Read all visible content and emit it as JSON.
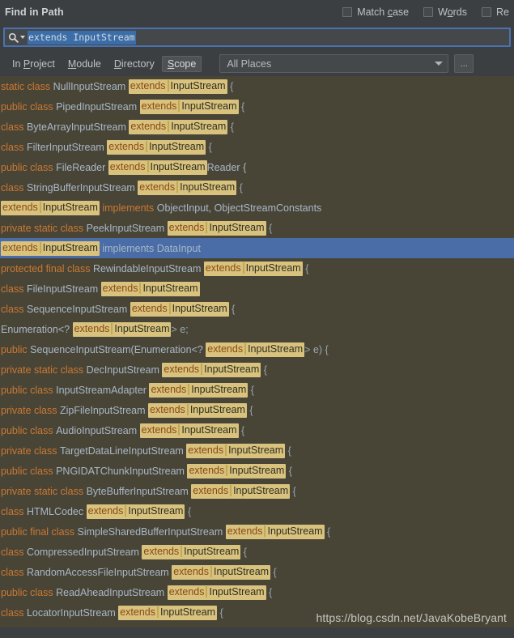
{
  "dialog": {
    "title": "Find in Path"
  },
  "options": [
    {
      "id": "match-case",
      "label_before": "Match ",
      "mnemonic": "c",
      "label_after": "ase",
      "checked": false
    },
    {
      "id": "words",
      "label_before": "W",
      "mnemonic": "o",
      "label_after": "rds",
      "checked": false
    },
    {
      "id": "regex",
      "label_before": "Re",
      "mnemonic": "",
      "label_after": "",
      "checked": false
    }
  ],
  "search": {
    "icon": "search-icon",
    "value": "extends InputStream",
    "selected": true
  },
  "scope": {
    "tabs": [
      {
        "id": "in-project",
        "before": "In ",
        "mnemonic": "P",
        "after": "roject",
        "selected": false
      },
      {
        "id": "module",
        "before": "",
        "mnemonic": "M",
        "after": "odule",
        "selected": false
      },
      {
        "id": "directory",
        "before": "",
        "mnemonic": "D",
        "after": "irectory",
        "selected": false
      },
      {
        "id": "scope",
        "before": "",
        "mnemonic": "S",
        "after": "cope",
        "selected": true
      }
    ],
    "place_value": "All Places",
    "ellipsis_label": "..."
  },
  "results": {
    "highlight_text": {
      "keyword": "extends",
      "identifier": "InputStream"
    },
    "rows": [
      {
        "selected": false,
        "parts": [
          {
            "t": "kw",
            "v": "static class "
          },
          {
            "t": "plain",
            "v": "NullInputStream "
          },
          {
            "t": "hl"
          },
          {
            "t": "punc",
            "v": " {"
          }
        ]
      },
      {
        "selected": false,
        "parts": [
          {
            "t": "kw",
            "v": "public class "
          },
          {
            "t": "plain",
            "v": "PipedInputStream "
          },
          {
            "t": "hl"
          },
          {
            "t": "punc",
            "v": " {"
          }
        ]
      },
      {
        "selected": false,
        "parts": [
          {
            "t": "kw",
            "v": "class "
          },
          {
            "t": "plain",
            "v": "ByteArrayInputStream "
          },
          {
            "t": "hl"
          },
          {
            "t": "punc",
            "v": " {"
          }
        ]
      },
      {
        "selected": false,
        "parts": [
          {
            "t": "kw",
            "v": "class "
          },
          {
            "t": "plain",
            "v": "FilterInputStream "
          },
          {
            "t": "hl"
          },
          {
            "t": "punc",
            "v": " {"
          }
        ]
      },
      {
        "selected": false,
        "parts": [
          {
            "t": "kw",
            "v": "public class "
          },
          {
            "t": "plain",
            "v": "FileReader "
          },
          {
            "t": "hl"
          },
          {
            "t": "plain",
            "v": "Reader {"
          }
        ]
      },
      {
        "selected": false,
        "parts": [
          {
            "t": "kw",
            "v": "class "
          },
          {
            "t": "plain",
            "v": "StringBufferInputStream "
          },
          {
            "t": "hl"
          },
          {
            "t": "punc",
            "v": " {"
          }
        ]
      },
      {
        "selected": false,
        "parts": [
          {
            "t": "hl"
          },
          {
            "t": "kw",
            "v": " implements "
          },
          {
            "t": "plain",
            "v": "ObjectInput, ObjectStreamConstants"
          }
        ]
      },
      {
        "selected": false,
        "parts": [
          {
            "t": "kw",
            "v": "private static class "
          },
          {
            "t": "plain",
            "v": "PeekInputStream "
          },
          {
            "t": "hl"
          },
          {
            "t": "punc",
            "v": " {"
          }
        ]
      },
      {
        "selected": true,
        "parts": [
          {
            "t": "hl"
          },
          {
            "t": "plain",
            "v": " implements DataInput"
          }
        ]
      },
      {
        "selected": false,
        "parts": [
          {
            "t": "kw",
            "v": "protected final class "
          },
          {
            "t": "plain",
            "v": "RewindableInputStream "
          },
          {
            "t": "hl"
          },
          {
            "t": "punc",
            "v": " {"
          }
        ]
      },
      {
        "selected": false,
        "parts": [
          {
            "t": "kw",
            "v": "class "
          },
          {
            "t": "plain",
            "v": "FileInputStream "
          },
          {
            "t": "hl"
          }
        ]
      },
      {
        "selected": false,
        "parts": [
          {
            "t": "kw",
            "v": "class "
          },
          {
            "t": "plain",
            "v": "SequenceInputStream "
          },
          {
            "t": "hl"
          },
          {
            "t": "punc",
            "v": " {"
          }
        ]
      },
      {
        "selected": false,
        "parts": [
          {
            "t": "plain",
            "v": "Enumeration<? "
          },
          {
            "t": "hl"
          },
          {
            "t": "punc",
            "v": "> e;"
          }
        ]
      },
      {
        "selected": false,
        "parts": [
          {
            "t": "kw",
            "v": "public "
          },
          {
            "t": "plain",
            "v": "SequenceInputStream(Enumeration<? "
          },
          {
            "t": "hl"
          },
          {
            "t": "punc",
            "v": "> e) {"
          }
        ]
      },
      {
        "selected": false,
        "parts": [
          {
            "t": "kw",
            "v": "private static class "
          },
          {
            "t": "plain",
            "v": "DecInputStream "
          },
          {
            "t": "hl"
          },
          {
            "t": "punc",
            "v": " {"
          }
        ]
      },
      {
        "selected": false,
        "parts": [
          {
            "t": "kw",
            "v": "public class "
          },
          {
            "t": "plain",
            "v": "InputStreamAdapter "
          },
          {
            "t": "hl"
          },
          {
            "t": "punc",
            "v": " {"
          }
        ]
      },
      {
        "selected": false,
        "parts": [
          {
            "t": "kw",
            "v": "private class "
          },
          {
            "t": "plain",
            "v": "ZipFileInputStream "
          },
          {
            "t": "hl"
          },
          {
            "t": "punc",
            "v": " {"
          }
        ]
      },
      {
        "selected": false,
        "parts": [
          {
            "t": "kw",
            "v": "public class "
          },
          {
            "t": "plain",
            "v": "AudioInputStream "
          },
          {
            "t": "hl"
          },
          {
            "t": "punc",
            "v": " {"
          }
        ]
      },
      {
        "selected": false,
        "parts": [
          {
            "t": "kw",
            "v": "private class "
          },
          {
            "t": "plain",
            "v": "TargetDataLineInputStream "
          },
          {
            "t": "hl"
          },
          {
            "t": "punc",
            "v": " {"
          }
        ]
      },
      {
        "selected": false,
        "parts": [
          {
            "t": "kw",
            "v": "public class "
          },
          {
            "t": "plain",
            "v": "PNGIDATChunkInputStream "
          },
          {
            "t": "hl"
          },
          {
            "t": "punc",
            "v": " {"
          }
        ]
      },
      {
        "selected": false,
        "parts": [
          {
            "t": "kw",
            "v": "private static class "
          },
          {
            "t": "plain",
            "v": "ByteBufferInputStream "
          },
          {
            "t": "hl"
          },
          {
            "t": "punc",
            "v": " {"
          }
        ]
      },
      {
        "selected": false,
        "parts": [
          {
            "t": "kw",
            "v": "class "
          },
          {
            "t": "plain",
            "v": "HTMLCodec "
          },
          {
            "t": "hl"
          },
          {
            "t": "punc",
            "v": " {"
          }
        ]
      },
      {
        "selected": false,
        "parts": [
          {
            "t": "kw",
            "v": "public final class "
          },
          {
            "t": "plain",
            "v": "SimpleSharedBufferInputStream "
          },
          {
            "t": "hl"
          },
          {
            "t": "punc",
            "v": " {"
          }
        ]
      },
      {
        "selected": false,
        "parts": [
          {
            "t": "kw",
            "v": "class "
          },
          {
            "t": "plain",
            "v": "CompressedInputStream "
          },
          {
            "t": "hl"
          },
          {
            "t": "punc",
            "v": " {"
          }
        ]
      },
      {
        "selected": false,
        "parts": [
          {
            "t": "kw",
            "v": "class "
          },
          {
            "t": "plain",
            "v": "RandomAccessFileInputStream "
          },
          {
            "t": "hl"
          },
          {
            "t": "punc",
            "v": " {"
          }
        ]
      },
      {
        "selected": false,
        "parts": [
          {
            "t": "kw",
            "v": "public class "
          },
          {
            "t": "plain",
            "v": "ReadAheadInputStream "
          },
          {
            "t": "hl"
          },
          {
            "t": "punc",
            "v": " {"
          }
        ]
      },
      {
        "selected": false,
        "parts": [
          {
            "t": "kw",
            "v": "class "
          },
          {
            "t": "plain",
            "v": "LocatorInputStream "
          },
          {
            "t": "hl"
          },
          {
            "t": "punc",
            "v": " {"
          }
        ]
      }
    ],
    "watermark": "https://blog.csdn.net/JavaKobeBryant"
  },
  "colors": {
    "header_bg": "#3c3f41",
    "results_bg": "#484537",
    "selection_blue": "#4a6da7",
    "match_highlight": "#d8c27d",
    "keyword_orange": "#cc7832",
    "identifier_gray": "#a9b7c6",
    "field_focus_border": "#4a72b0"
  }
}
